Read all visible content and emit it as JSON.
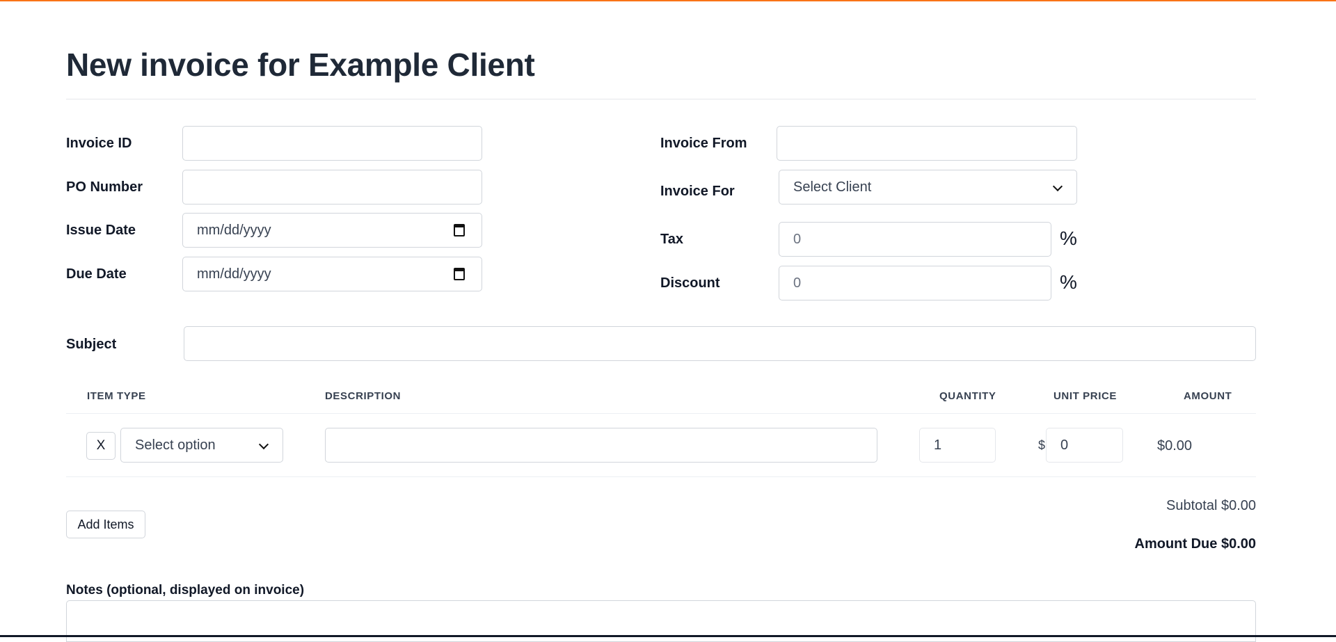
{
  "page": {
    "title": "New invoice for Example Client",
    "accent_color": "#f97316"
  },
  "form": {
    "invoice_id": {
      "label": "Invoice ID",
      "value": ""
    },
    "po_number": {
      "label": "PO Number",
      "value": ""
    },
    "issue_date": {
      "label": "Issue Date",
      "placeholder": "mm/dd/yyyy"
    },
    "due_date": {
      "label": "Due Date",
      "placeholder": "mm/dd/yyyy"
    },
    "invoice_from": {
      "label": "Invoice From",
      "value": ""
    },
    "invoice_for": {
      "label": "Invoice For",
      "selected": "Select Client"
    },
    "tax": {
      "label": "Tax",
      "placeholder": "0",
      "unit": "%"
    },
    "discount": {
      "label": "Discount",
      "placeholder": "0",
      "unit": "%"
    },
    "subject": {
      "label": "Subject",
      "value": ""
    }
  },
  "items_table": {
    "columns": [
      "ITEM TYPE",
      "DESCRIPTION",
      "QUANTITY",
      "UNIT PRICE",
      "AMOUNT"
    ],
    "rows": [
      {
        "remove_label": "X",
        "item_type": "Select option",
        "description": "",
        "quantity": "1",
        "currency": "$",
        "unit_price": "0",
        "amount": "$0.00"
      }
    ]
  },
  "actions": {
    "add_items_label": "Add Items"
  },
  "totals": {
    "subtotal": "Subtotal $0.00",
    "amount_due": "Amount Due $0.00"
  },
  "notes": {
    "label": "Notes (optional, displayed on invoice)",
    "value": ""
  }
}
